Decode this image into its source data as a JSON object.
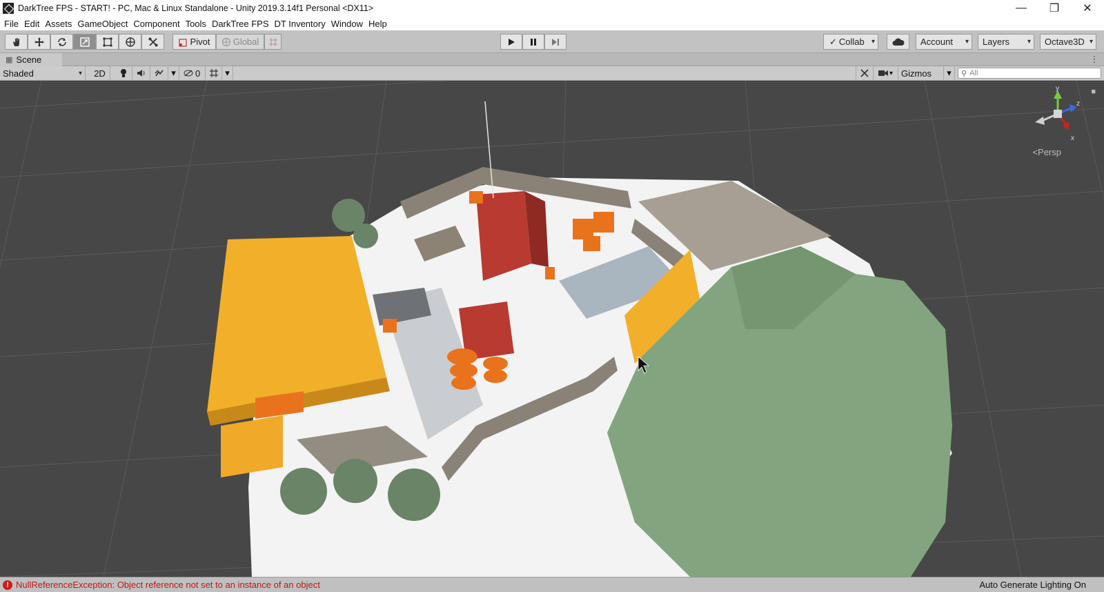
{
  "window": {
    "title": "DarkTree FPS - START! - PC, Mac & Linux Standalone - Unity 2019.3.14f1 Personal <DX11>",
    "controls": [
      "minimize-icon",
      "restore-icon",
      "close-icon"
    ]
  },
  "menu": [
    "File",
    "Edit",
    "Assets",
    "GameObject",
    "Component",
    "Tools",
    "DarkTree FPS",
    "DT Inventory",
    "Window",
    "Help"
  ],
  "toolbar": {
    "transform_tools": [
      "hand-tool-icon",
      "move-tool-icon",
      "rotate-tool-icon",
      "scale-tool-icon",
      "rect-tool-icon",
      "transform-tool-icon",
      "custom-tool-icon"
    ],
    "active_tool": "scale-tool-icon",
    "pivot_label": "Pivot",
    "global_label": "Global",
    "play_icons": [
      "play-icon",
      "pause-icon",
      "step-icon"
    ],
    "collab_label": "Collab",
    "account_label": "Account",
    "layers_label": "Layers",
    "layout_label": "Octave3D"
  },
  "scene_tab": {
    "label": "Scene"
  },
  "scene_toolbar": {
    "draw_mode": "Shaded",
    "mode_2d": "2D",
    "hidden_count": "0",
    "gizmos_label": "Gizmos",
    "search_placeholder": "All"
  },
  "viewport": {
    "projection_label": "Persp",
    "gizmo_axes": [
      "y",
      "z",
      "x"
    ]
  },
  "status": {
    "error_text": "NullReferenceException: Object reference not set to an instance of an object",
    "right_text": "Auto Generate Lighting On"
  },
  "colors": {
    "viewport_bg": "#474747",
    "ground": "#f2f2f2",
    "hill": "#82a57f",
    "roof_yellow": "#f2b02a",
    "container_red": "#b83a30",
    "barrel_orange": "#e8731c",
    "error_red": "#c21515"
  }
}
